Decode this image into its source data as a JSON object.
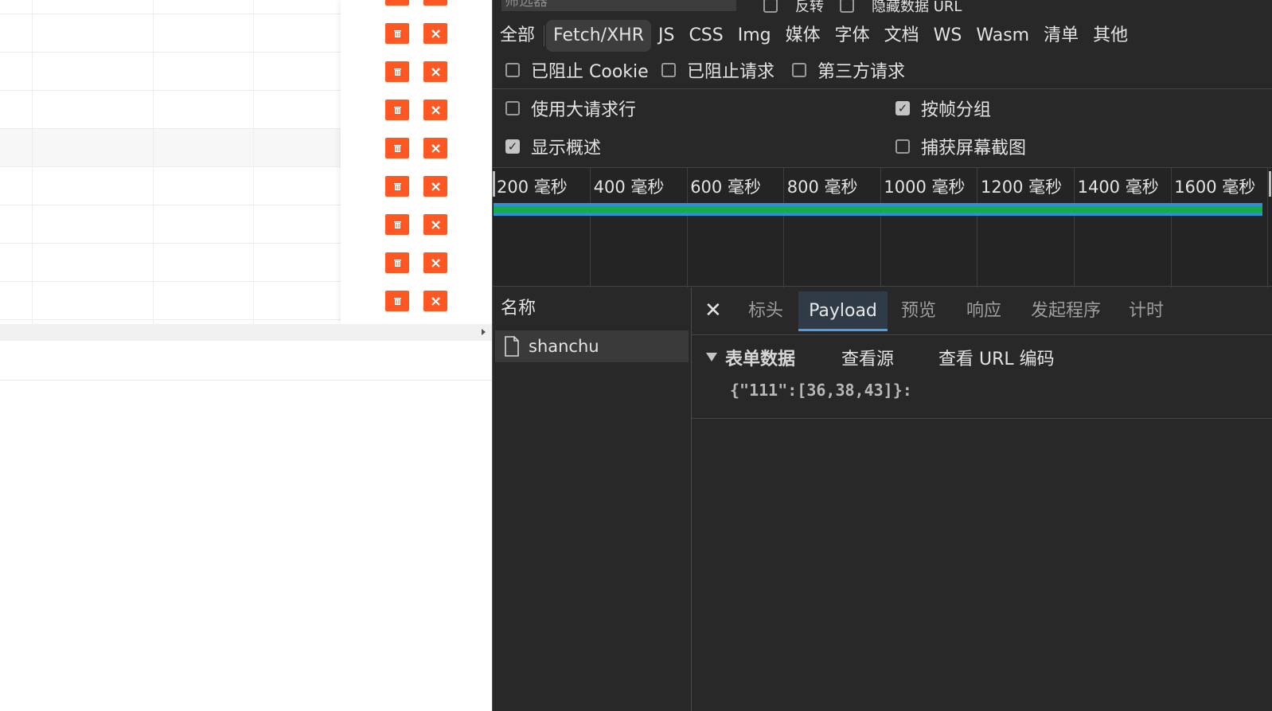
{
  "table": {
    "rows": [
      {
        "highlight": false
      },
      {
        "highlight": false
      },
      {
        "highlight": false
      },
      {
        "highlight": true
      },
      {
        "highlight": false
      },
      {
        "highlight": false
      },
      {
        "highlight": false
      },
      {
        "highlight": false
      }
    ],
    "delete_icon": "trash-icon",
    "tool_icon": "tools-icon"
  },
  "devtools": {
    "filter_placeholder": "筛选器",
    "top_checkboxes": [
      {
        "label": "反转",
        "checked": false
      },
      {
        "label": "隐藏数据 URL",
        "checked": false
      }
    ],
    "type_filters": [
      "全部",
      "Fetch/XHR",
      "JS",
      "CSS",
      "Img",
      "媒体",
      "字体",
      "文档",
      "WS",
      "Wasm",
      "清单",
      "其他"
    ],
    "active_type": "Fetch/XHR",
    "blocked_checkboxes": [
      {
        "label": "已阻止 Cookie",
        "checked": false
      },
      {
        "label": "已阻止请求",
        "checked": false
      },
      {
        "label": "第三方请求",
        "checked": false
      }
    ],
    "settings": {
      "large_rows": {
        "label": "使用大请求行",
        "checked": false
      },
      "group_by_frame": {
        "label": "按帧分组",
        "checked": true
      },
      "show_overview": {
        "label": "显示概述",
        "checked": true
      },
      "capture_screenshots": {
        "label": "捕获屏幕截图",
        "checked": false
      }
    },
    "overview": {
      "ticks": [
        "200 毫秒",
        "400 毫秒",
        "600 毫秒",
        "800 毫秒",
        "1000 毫秒",
        "1200 毫秒",
        "1400 毫秒",
        "1600 毫秒"
      ],
      "colors": {
        "waiting": "#2d8fd5",
        "content": "#17a94c"
      }
    },
    "requests": {
      "header": "名称",
      "items": [
        {
          "name": "shanchu",
          "icon": "document-icon"
        }
      ]
    },
    "detail": {
      "tabs": [
        "标头",
        "Payload",
        "预览",
        "响应",
        "发起程序",
        "计时"
      ],
      "active_tab": "Payload",
      "section_title": "表单数据",
      "view_source": "查看源",
      "view_url_encoded": "查看 URL 编码",
      "payload": "{\"111\":[36,38,43]}:"
    }
  }
}
